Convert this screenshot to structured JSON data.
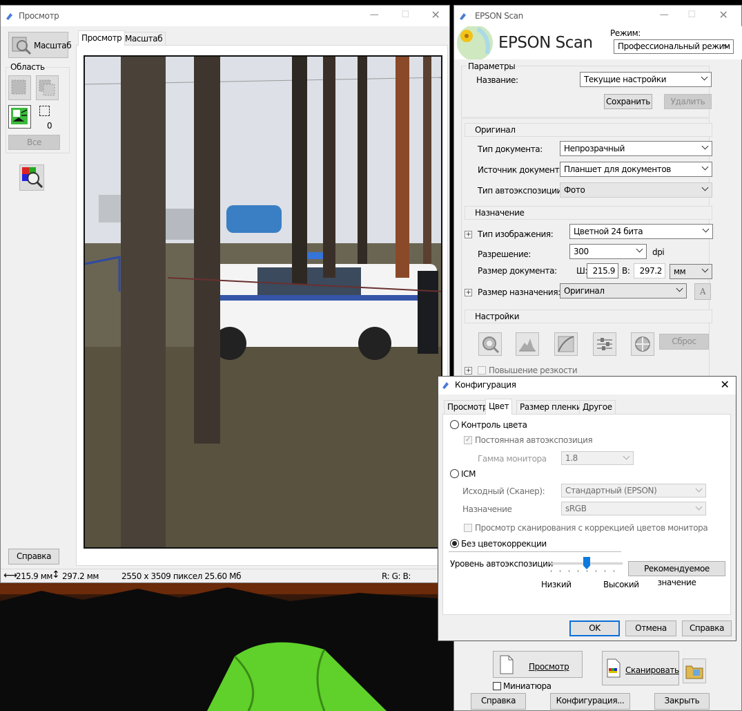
{
  "preview_window": {
    "title": "Просмотр",
    "zoom_button": "Масштаб",
    "area_label": "Область",
    "area_count": "0",
    "all_button": "Все",
    "help_button": "Справка",
    "tabs": [
      "Просмотр",
      "Масштаб"
    ],
    "status": {
      "width": "215.9 мм",
      "height": "297.2 мм",
      "pixels": "2550 x 3509 пиксел 25.60 Мб",
      "rgb": "R: G: B:"
    }
  },
  "epson_window": {
    "title": "EPSON Scan",
    "brand": "EPSON Scan",
    "mode_label": "Режим:",
    "mode_value": "Профессиональный режим",
    "params_label": "Параметры",
    "name_label": "Название:",
    "name_value": "Текущие настройки",
    "save_button": "Сохранить",
    "delete_button": "Удалить",
    "original_header": "Оригинал",
    "doc_type_label": "Тип документа:",
    "doc_type_value": "Непрозрачный",
    "doc_source_label": "Источник документа:",
    "doc_source_value": "Планшет для документов",
    "auto_exposure_label": "Тип автоэкспозиции:",
    "auto_exposure_value": "Фото",
    "dest_header": "Назначение",
    "image_type_label": "Тип изображения:",
    "image_type_value": "Цветной 24 бита",
    "resolution_label": "Разрешение:",
    "resolution_value": "300",
    "dpi": "dpi",
    "doc_size_label": "Размер документа:",
    "w_label": "Ш:",
    "w_value": "215.9",
    "h_label": "В:",
    "h_value": "297.2",
    "unit_value": "мм",
    "target_size_label": "Размер назначения:",
    "target_size_value": "Оригинал",
    "settings_header": "Настройки",
    "reset_button": "Сброс",
    "sharpen_label": "Повышение резкости",
    "preview_button": "Просмотр",
    "scan_button": "Сканировать",
    "thumbnail_label": "Миниатюра",
    "help_button": "Справка",
    "config_button": "Конфигурация...",
    "close_button": "Закрыть"
  },
  "config_dialog": {
    "title": "Конфигурация",
    "tabs": [
      "Просмотр",
      "Цвет",
      "Размер пленки",
      "Другое"
    ],
    "color_control": "Контроль цвета",
    "continuous_ae": "Постоянная автоэкспозиция",
    "gamma_label": "Гамма монитора",
    "gamma_value": "1.8",
    "icm": "ICM",
    "source_label": "Исходный (Сканер):",
    "source_value": "Стандартный (EPSON)",
    "target_label": "Назначение",
    "target_value": "sRGB",
    "preview_monitor": "Просмотр сканирования с коррекцией цветов монитора",
    "no_correction": "Без цветокоррекции",
    "ae_level_label": "Уровень автоэкспозиции",
    "recommended_button": "Рекомендуемое значение",
    "low": "Низкий",
    "high": "Высокий",
    "slider_level": 0.5,
    "ok": "OK",
    "cancel": "Отмена",
    "help": "Справка"
  }
}
